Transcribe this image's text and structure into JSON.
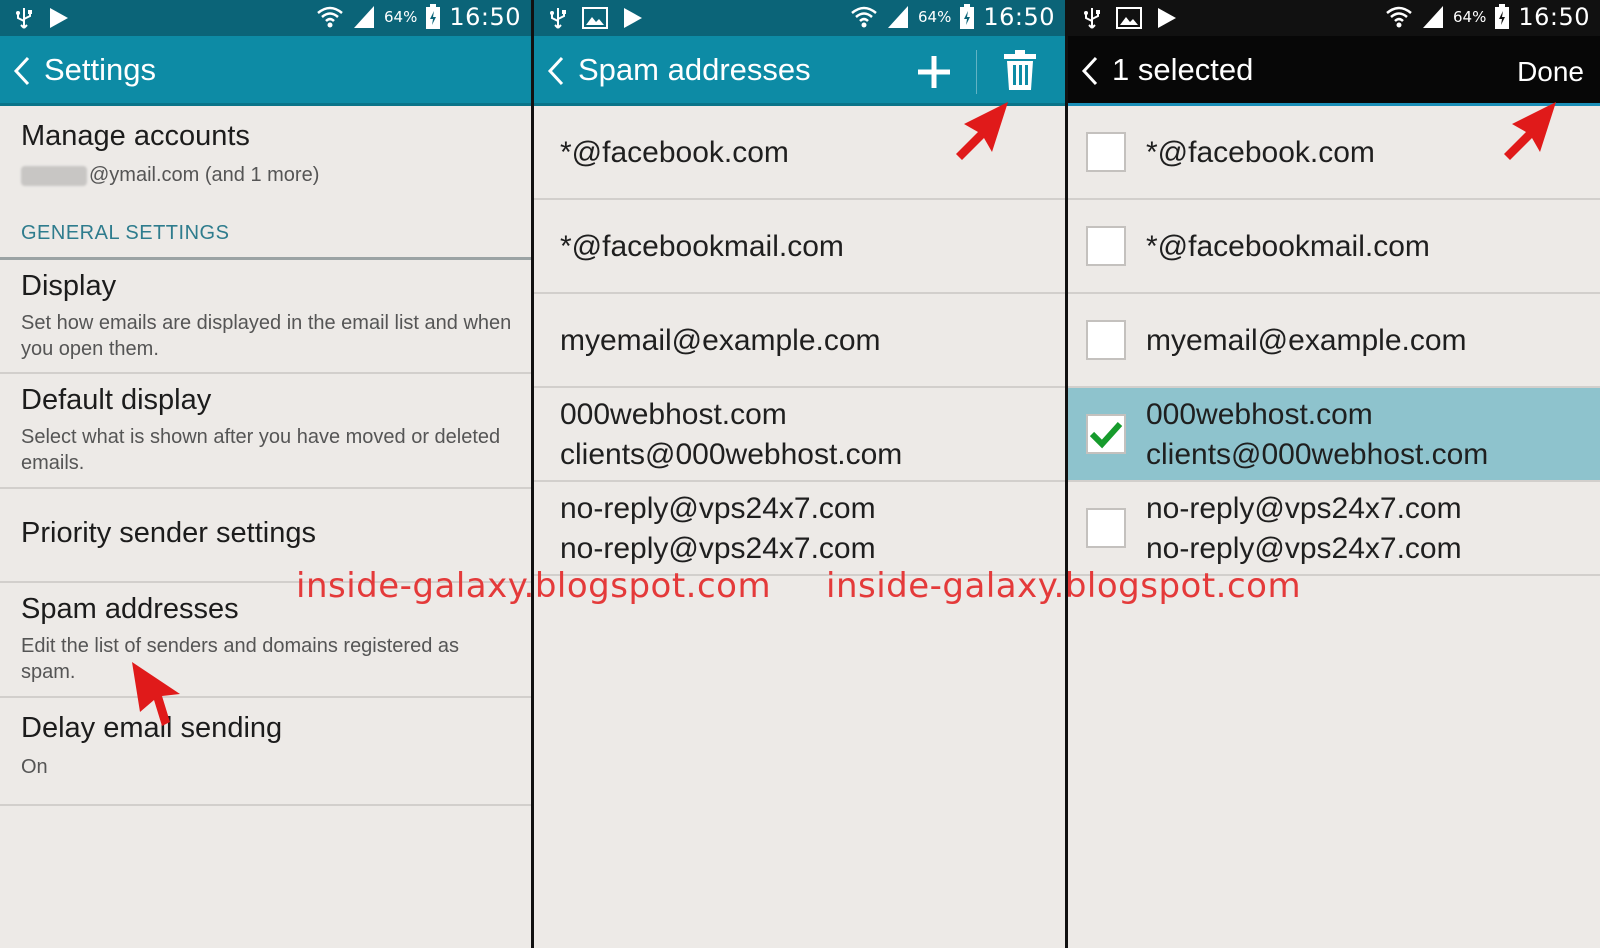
{
  "status": {
    "battery_percent": "64%",
    "clock": "16:50"
  },
  "colors": {
    "teal_actionbar": "#0d8ba5",
    "teal_statusbar": "#0b6478",
    "selected_row": "#8ec3cd",
    "checkmark_green": "#169b2c",
    "arrow_red": "#e01a1a",
    "watermark_red": "#e43a3a"
  },
  "screen1": {
    "title": "Settings",
    "manage_accounts": {
      "title": "Manage accounts",
      "subtitle": "@ymail.com (and 1 more)"
    },
    "section_header": "GENERAL SETTINGS",
    "items": [
      {
        "title": "Display",
        "subtitle": "Set how emails are displayed in the email list and when you open them."
      },
      {
        "title": "Default display",
        "subtitle": "Select what is shown after you have moved or deleted emails."
      },
      {
        "title": "Priority sender settings",
        "subtitle": ""
      },
      {
        "title": "Spam addresses",
        "subtitle": "Edit the list of senders and domains registered as spam."
      },
      {
        "title": "Delay email sending",
        "subtitle": "On"
      }
    ]
  },
  "screen2": {
    "title": "Spam addresses",
    "rows": [
      {
        "line1": "*@facebook.com",
        "line2": ""
      },
      {
        "line1": "*@facebookmail.com",
        "line2": ""
      },
      {
        "line1": "myemail@example.com",
        "line2": ""
      },
      {
        "line1": "000webhost.com",
        "line2": "clients@000webhost.com"
      },
      {
        "line1": "no-reply@vps24x7.com",
        "line2": "no-reply@vps24x7.com"
      }
    ]
  },
  "screen3": {
    "title": "1 selected",
    "done_label": "Done",
    "rows": [
      {
        "line1": "*@facebook.com",
        "line2": "",
        "checked": false
      },
      {
        "line1": "*@facebookmail.com",
        "line2": "",
        "checked": false
      },
      {
        "line1": "myemail@example.com",
        "line2": "",
        "checked": false
      },
      {
        "line1": "000webhost.com",
        "line2": "clients@000webhost.com",
        "checked": true
      },
      {
        "line1": "no-reply@vps24x7.com",
        "line2": "no-reply@vps24x7.com",
        "checked": false
      }
    ]
  },
  "watermarks": [
    "inside-galaxy.blogspot.com",
    "inside-galaxy.blogspot.com"
  ]
}
